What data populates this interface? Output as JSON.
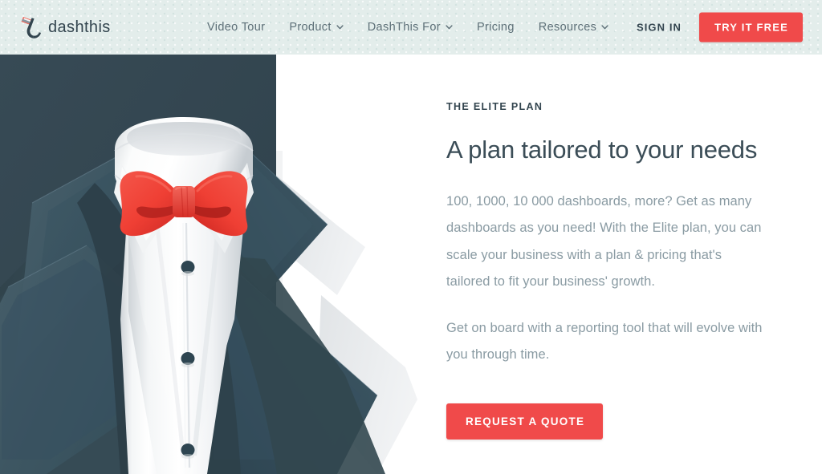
{
  "header": {
    "brand": {
      "name": "dashthis",
      "logo_icon": "dashthis-swoosh-logo"
    },
    "nav": [
      {
        "label": "Video Tour",
        "has_dropdown": false
      },
      {
        "label": "Product",
        "has_dropdown": true
      },
      {
        "label": "DashThis For",
        "has_dropdown": true
      },
      {
        "label": "Pricing",
        "has_dropdown": false
      },
      {
        "label": "Resources",
        "has_dropdown": true
      }
    ],
    "sign_in_label": "SIGN IN",
    "try_free_label": "TRY IT FREE",
    "background_color": "#E3EDEB",
    "accent_color": "#F04A4A"
  },
  "hero": {
    "eyebrow": "THE ELITE PLAN",
    "headline": "A plan tailored to your needs",
    "paragraph_1": "100, 1000, 10 000 dashboards, more? Get as many dashboards as you need! With the Elite plan, you can scale your business with a plan & pricing that's tailored to fit your business' growth.",
    "paragraph_2": "Get on board with a reporting tool that will evolve with you through time.",
    "cta_label": "REQUEST A QUOTE",
    "heading_color": "#3B4D57",
    "body_color": "#8A9BA3",
    "cta_color": "#F04A4A"
  },
  "illustration": {
    "name": "tuxedo-with-red-bowtie",
    "panel_color": "#33454F",
    "suit_color": "#3A5360",
    "shirt_color": "#FFFFFF",
    "bowtie_color": "#EF4136",
    "button_color": "#2E4551",
    "shirt_button_count": 3
  }
}
